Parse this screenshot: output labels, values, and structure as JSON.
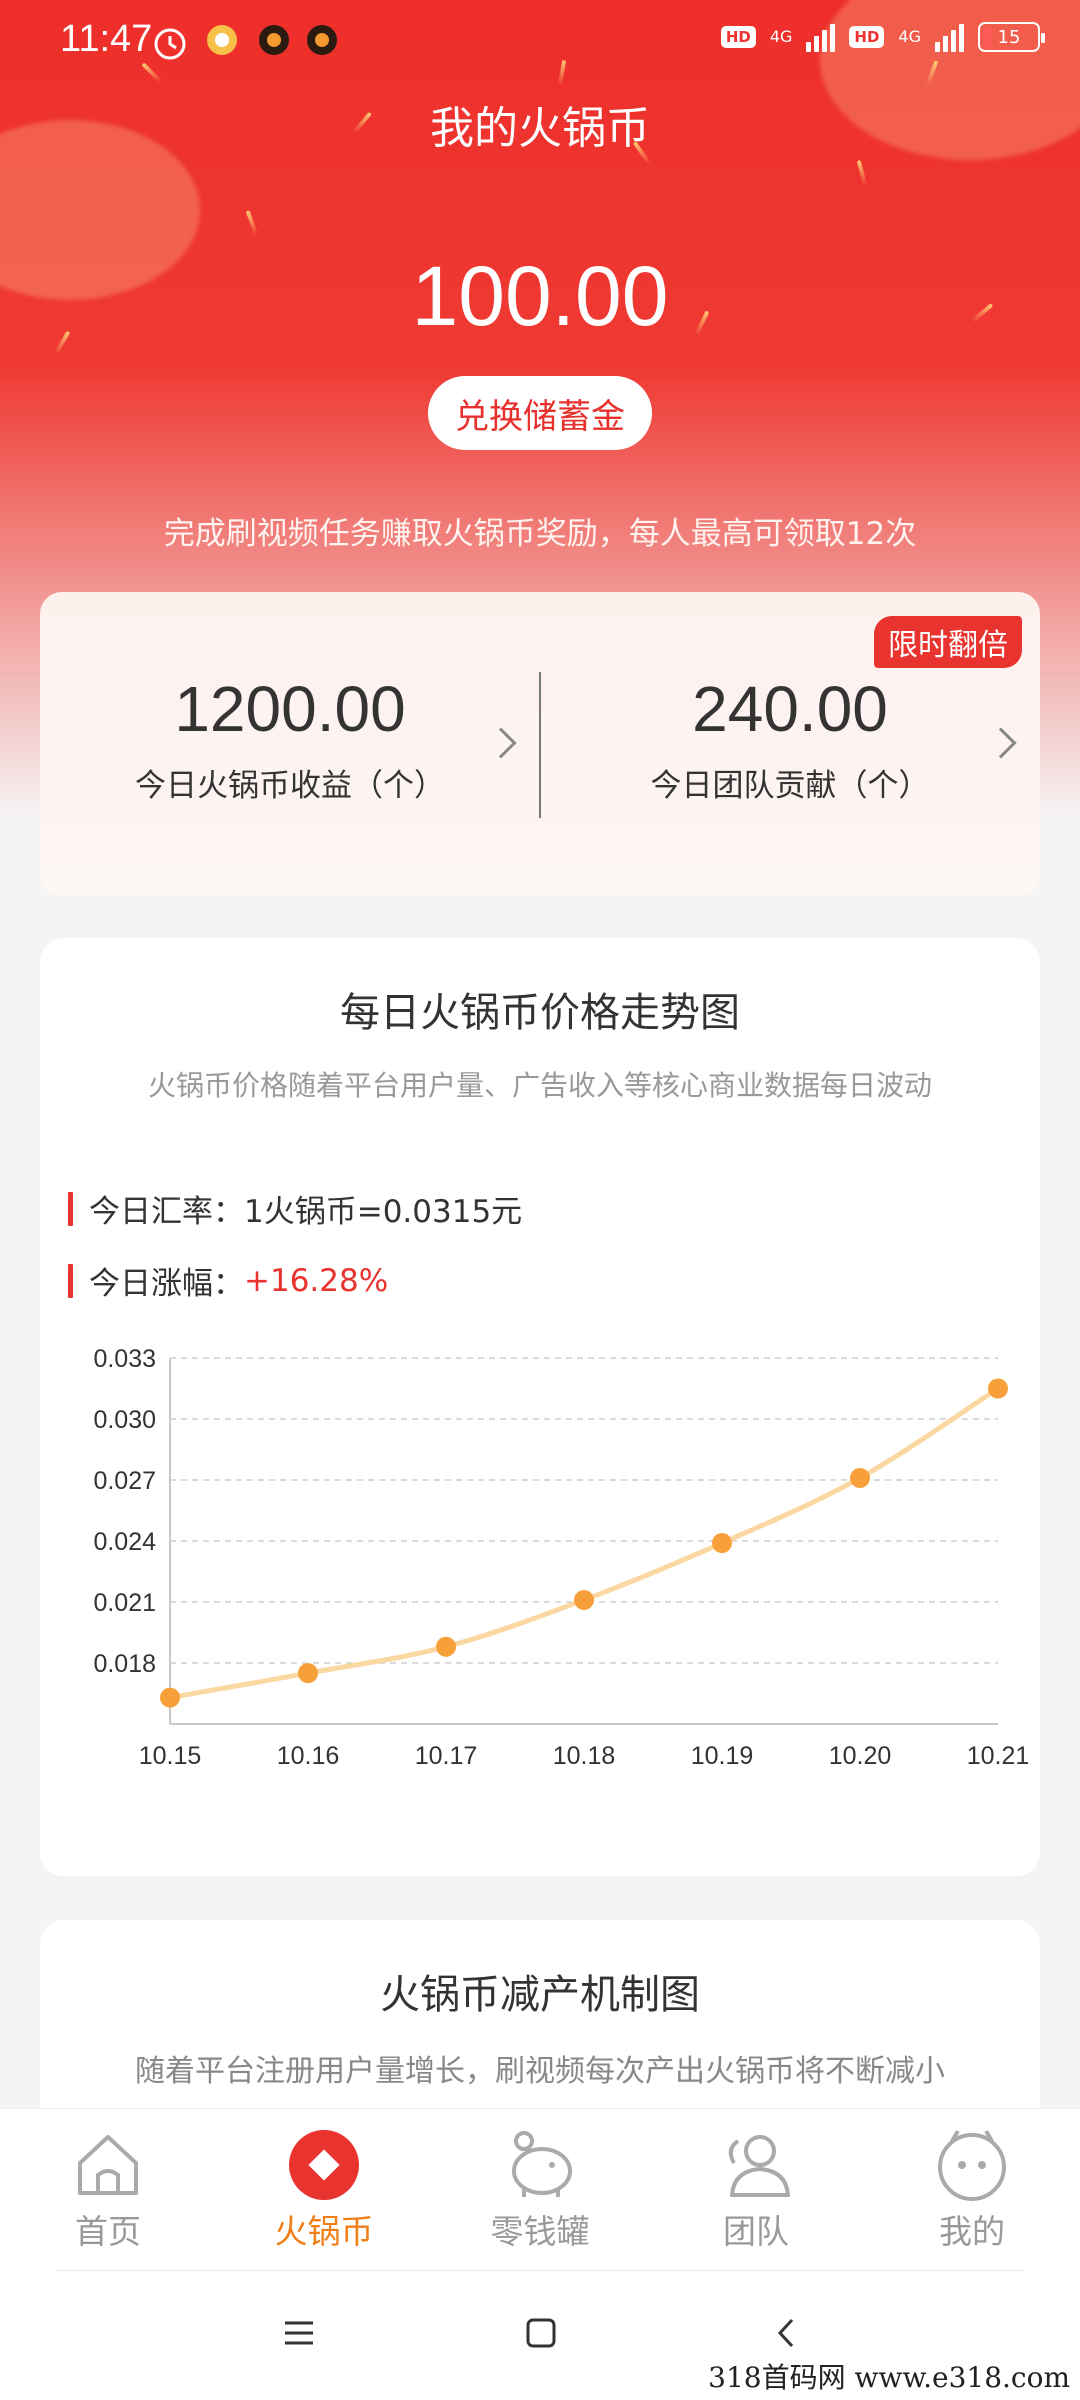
{
  "status_bar": {
    "time": "11:47",
    "hd1": "HD",
    "net1": "4G",
    "hd2": "HD",
    "net2": "4G",
    "battery": "15"
  },
  "header": {
    "title": "我的火锅币",
    "balance": "100.00",
    "exchange_button": "兑换储蓄金",
    "subtitle": "完成刷视频任务赚取火锅币奖励，每人最高可领取12次"
  },
  "stats": {
    "badge": "限时翻倍",
    "items": [
      {
        "value": "1200.00",
        "label": "今日火锅币收益（个）"
      },
      {
        "value": "240.00",
        "label": "今日团队贡献（个）"
      }
    ]
  },
  "price_card": {
    "title": "每日火锅币价格走势图",
    "description": "火锅币价格随着平台用户量、广告收入等核心商业数据每日波动",
    "rate_label": "今日汇率：",
    "rate_value": "1火锅币=0.0315元",
    "change_label": "今日涨幅：",
    "change_value": "+16.28%"
  },
  "chart_data": {
    "type": "line",
    "categories": [
      "10.15",
      "10.16",
      "10.17",
      "10.18",
      "10.19",
      "10.20",
      "10.21"
    ],
    "values": [
      0.0163,
      0.0175,
      0.0188,
      0.0211,
      0.0239,
      0.0271,
      0.0315
    ],
    "ylim": [
      0.015,
      0.033
    ],
    "yticks": [
      "0.018",
      "0.021",
      "0.024",
      "0.027",
      "0.030",
      "0.033"
    ],
    "ytick_values": [
      0.018,
      0.021,
      0.024,
      0.027,
      0.03,
      0.033
    ],
    "grid": true,
    "colors": {
      "line": "#fbd7a2",
      "point": "#f7a03a"
    }
  },
  "reduce_card": {
    "title": "火锅币减产机制图",
    "description": "随着平台注册用户量增长，刷视频每次产出火锅币将不断减小"
  },
  "tabbar": {
    "items": [
      {
        "label": "首页",
        "icon": "home-icon"
      },
      {
        "label": "火锅币",
        "icon": "coin-icon"
      },
      {
        "label": "零钱罐",
        "icon": "piggy-bank-icon"
      },
      {
        "label": "团队",
        "icon": "team-icon"
      },
      {
        "label": "我的",
        "icon": "profile-icon"
      }
    ],
    "active": "火锅币"
  },
  "watermark": "318首码网   www.e318.com",
  "colors": {
    "brand_red": "#ee2e2a",
    "accent_orange": "#f07f18"
  }
}
